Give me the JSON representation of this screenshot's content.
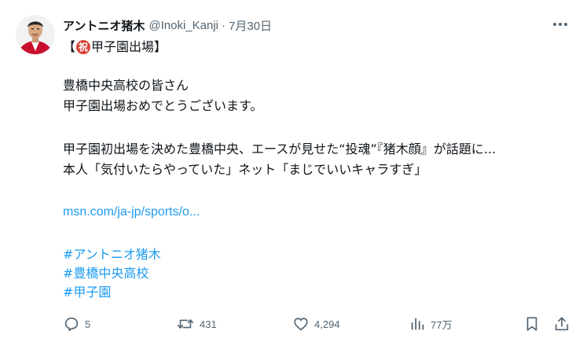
{
  "author": {
    "display_name": "アントニオ猪木",
    "handle": "@Inoki_Kanji",
    "separator": "·",
    "date": "7月30日"
  },
  "tweet": {
    "title_open": "【",
    "title_emoji": "祝",
    "title_text": "甲子園出場",
    "title_close": "】",
    "line1": "豊橋中央高校の皆さん",
    "line2": "甲子園出場おめでとうございます。",
    "line3": "甲子園初出場を決めた豊橋中央、エースが見せた“投魂”『猪木顔』が話題に...",
    "line4": "本人「気付いたらやっていた」ネット「まじでいいキャラすぎ」",
    "link": "msn.com/ja-jp/sports/o...",
    "hashtags": [
      "#アントニオ猪木",
      "#豊橋中央高校",
      "#甲子園"
    ]
  },
  "actions": {
    "reply_count": "5",
    "retweet_count": "431",
    "like_count": "4,294",
    "view_count": "77万"
  },
  "icons": {
    "more": "more-icon",
    "reply": "reply-icon",
    "retweet": "retweet-icon",
    "like": "heart-icon",
    "views": "views-icon",
    "bookmark": "bookmark-icon",
    "share": "share-icon"
  },
  "colors": {
    "link": "#1d9bf0",
    "text": "#0f1419",
    "secondary": "#536471",
    "avatar_bg": "#c8102e"
  }
}
